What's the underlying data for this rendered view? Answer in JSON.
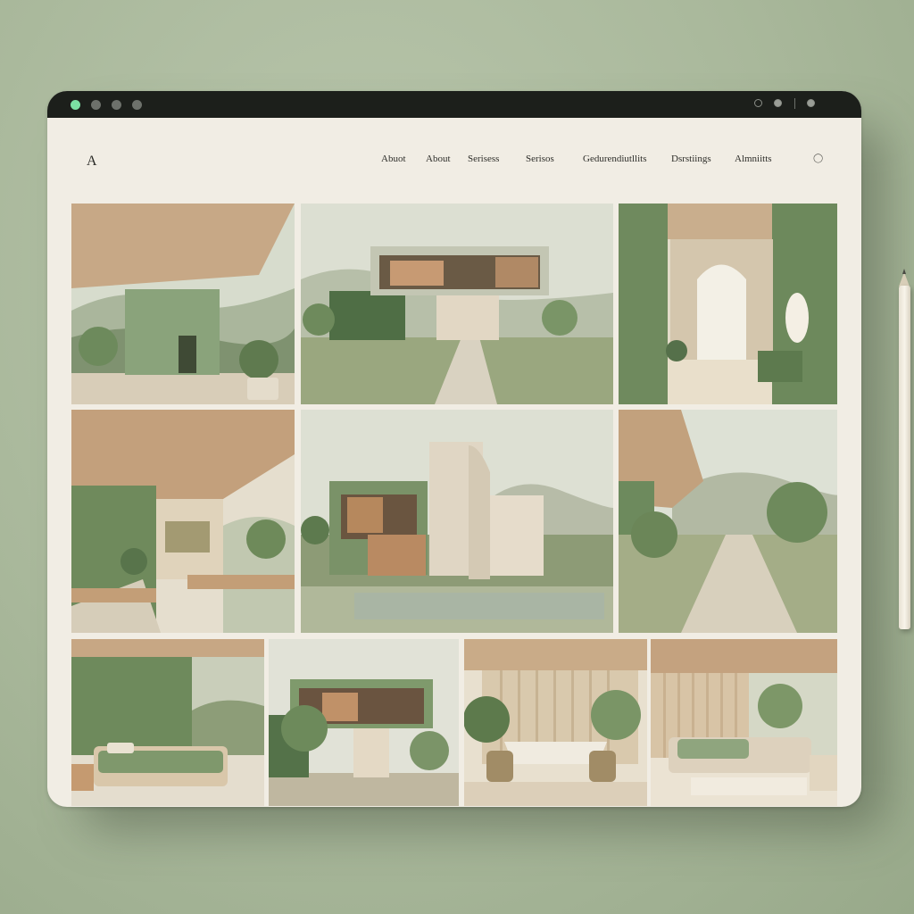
{
  "site": {
    "logo": "A",
    "nav": [
      "Abuot",
      "About",
      "Serisess",
      "Serisos",
      "Gedurendiutllits",
      "Dsrstiings",
      "Almniitts"
    ],
    "icons": [
      "cart-icon"
    ]
  },
  "titlebar": {
    "traffic_lights": [
      "close",
      "minimize",
      "maximize",
      "extra"
    ],
    "controls": [
      "refresh-icon",
      "settings-icon",
      "divider",
      "account-icon"
    ]
  },
  "gallery": {
    "rows": [
      [
        "canopy-house-entrance",
        "floating-box-house-path",
        "green-wall-arched-window-interior"
      ],
      [
        "open-living-room-under-canopy",
        "arched-tower-house-pond",
        "covered-walkway-landscape"
      ],
      [
        "green-bedroom",
        "cantilever-house-trees",
        "dining-room-slatted-wall",
        "bedroom-slatted-wall"
      ]
    ]
  },
  "colors": {
    "background": "#a9b89b",
    "frame": "#f1ede4",
    "titlebar": "#1c1f1b",
    "accent_green": "#6e8a5f",
    "accent_dot": "#7be0a3"
  }
}
